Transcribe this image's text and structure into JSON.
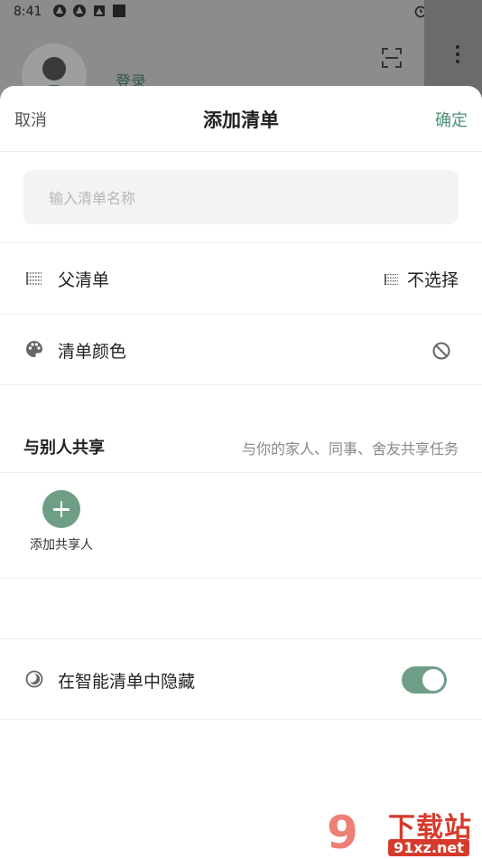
{
  "status_bar": {
    "time": "8:41"
  },
  "background_app": {
    "login_label": "登录"
  },
  "header": {
    "cancel": "取消",
    "title": "添加清单",
    "confirm": "确定"
  },
  "name_input": {
    "placeholder": "输入清单名称",
    "value": ""
  },
  "parent_list": {
    "label": "父清单",
    "value": "不选择"
  },
  "list_color": {
    "label": "清单颜色"
  },
  "share": {
    "title": "与别人共享",
    "description": "与你的家人、同事、舍友共享任务",
    "add_label": "添加共享人"
  },
  "hide_in_smart": {
    "label": "在智能清单中隐藏",
    "enabled": true
  },
  "watermark": {
    "top": "下载站",
    "bottom": "91xz.net",
    "logo": "9"
  },
  "colors": {
    "accent": "#4f8f73",
    "toggle_on": "#6e9f86"
  }
}
